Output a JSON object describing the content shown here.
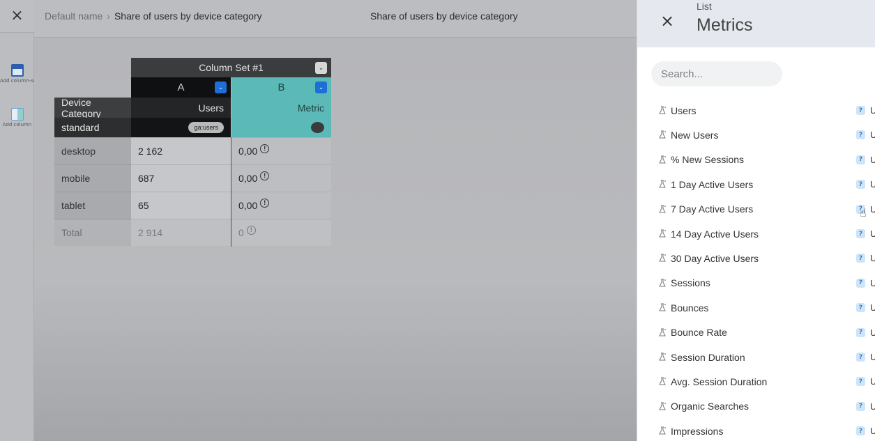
{
  "header": {
    "close_label": "×",
    "breadcrumb_root": "Default name",
    "breadcrumb_sep": "›",
    "breadcrumb_current": "Share of users by device category",
    "center_title": "Share of users by device category"
  },
  "rail": {
    "tools": [
      {
        "label": "Add column-set",
        "icon": "table-icon"
      },
      {
        "label": "Add column",
        "icon": "column-icon"
      }
    ]
  },
  "table": {
    "column_set_label": "Column Set #1",
    "column_a_letter": "A",
    "column_b_letter": "B",
    "dimension_label": "Device Category",
    "dimension_sub": "standard",
    "column_a_label": "Users",
    "column_a_tag": "ga:users",
    "column_b_label": "Metric",
    "rows": [
      {
        "label": "desktop",
        "a": "2 162",
        "b": "0,00"
      },
      {
        "label": "mobile",
        "a": "687",
        "b": "0,00"
      },
      {
        "label": "tablet",
        "a": "65",
        "b": "0,00"
      }
    ],
    "total": {
      "label": "Total",
      "a": "2 914",
      "b": "0"
    },
    "info_glyph": "!",
    "accent_color": "#5bbab7",
    "dropdown_color": "#1c6fd6"
  },
  "panel": {
    "close_label": "×",
    "kicker": "List",
    "title": "Metrics",
    "search_placeholder": "Search...",
    "help_glyph": "?",
    "trunc_glyph": "U",
    "metrics": [
      "Users",
      "New Users",
      "% New Sessions",
      "1 Day Active Users",
      "7 Day Active Users",
      "14 Day Active Users",
      "30 Day Active Users",
      "Sessions",
      "Bounces",
      "Bounce Rate",
      "Session Duration",
      "Avg. Session Duration",
      "Organic Searches",
      "Impressions"
    ]
  }
}
